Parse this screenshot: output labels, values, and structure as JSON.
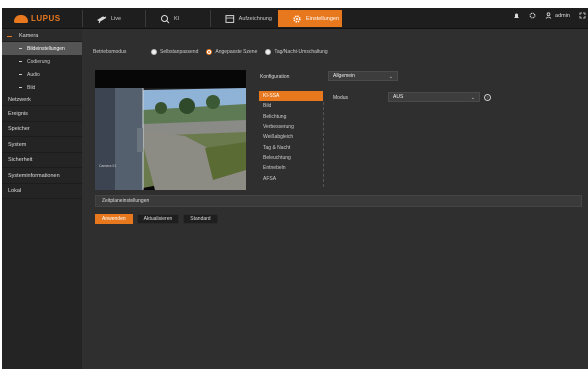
{
  "brand": {
    "logo_text": "LUPUS",
    "accent": "#e8781e"
  },
  "topnav": {
    "tabs": [
      {
        "label": "Live",
        "icon": "camera-icon"
      },
      {
        "label": "KI",
        "icon": "search-person-icon"
      },
      {
        "label": "Aufzeichnung",
        "icon": "recording-icon"
      },
      {
        "label": "Einstellungen",
        "icon": "gear-icon",
        "active": true
      }
    ],
    "user": "admin",
    "icons": [
      "alarm-icon",
      "settings-cog-icon",
      "user-icon",
      "fullscreen-icon"
    ]
  },
  "sidebar": {
    "items": [
      {
        "label": "Kamera",
        "open": true
      },
      {
        "label": "Netzwerk"
      },
      {
        "label": "Ereignis"
      },
      {
        "label": "Speicher"
      },
      {
        "label": "System"
      },
      {
        "label": "Sicherheit"
      },
      {
        "label": "Systeminformationen"
      },
      {
        "label": "Lokal"
      }
    ],
    "sub_items": [
      {
        "label": "Bildeinstellungen",
        "active": true
      },
      {
        "label": "Codierung"
      },
      {
        "label": "Audio"
      },
      {
        "label": "Bild"
      }
    ]
  },
  "main": {
    "mode_label": "Betriebsmodus",
    "modes": [
      {
        "label": "Selbstanpassend",
        "selected": false
      },
      {
        "label": "Angepasste Szene",
        "selected": true
      },
      {
        "label": "Tag/Nacht-Umschaltung",
        "selected": false
      }
    ],
    "config_label": "Konfiguration",
    "config_value": "Allgemein",
    "tabs": [
      "KI-SSA",
      "Bild",
      "Belichtung",
      "Verbesserung",
      "Weißabgleich",
      "Tag & Nacht",
      "Beleuchtung",
      "Entnebeln",
      "AFSA"
    ],
    "active_tab": "KI-SSA",
    "modus_label": "Modus",
    "modus_value": "AUS",
    "schedule_label": "Zeitplaneinstellungen",
    "buttons": {
      "apply": "Anwenden",
      "refresh": "Aktualisieren",
      "default": "Standard"
    }
  }
}
